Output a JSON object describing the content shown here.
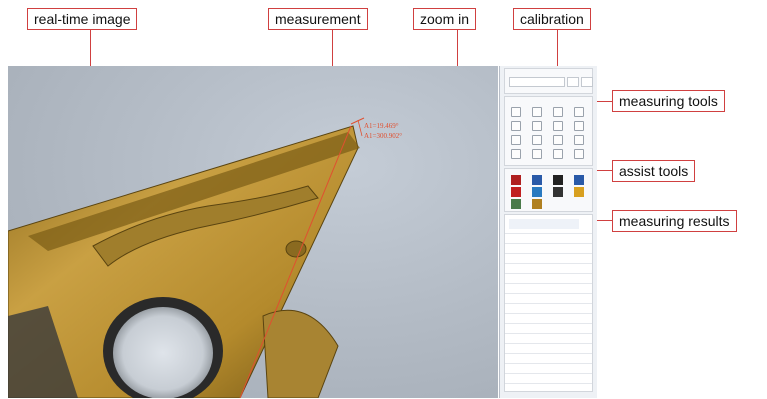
{
  "callouts": {
    "real_time_image": "real-time image",
    "measurement": "measurement",
    "zoom_in": "zoom in",
    "calibration": "calibration",
    "measuring_tools": "measuring tools",
    "assist_tools": "assist tools",
    "measuring_results": "measuring results"
  },
  "annotation_lines": [
    "A1=19.469°",
    "A1=300.902°"
  ],
  "tools": {
    "measuring": [
      "line-icon",
      "parallel-icon",
      "perpendicular-icon",
      "circle-icon",
      "rectangle-icon",
      "angle-icon",
      "arc-icon",
      "polygon-icon",
      "point-icon",
      "distance-icon",
      "radius-icon",
      "ellipse-icon",
      "curve-icon",
      "text-icon",
      "count-icon",
      "area-icon"
    ],
    "assist": [
      "color-icon",
      "edit-icon",
      "marker-icon",
      "camera-icon",
      "delete-icon",
      "save-icon",
      "clear-icon",
      "export-icon",
      "settings-icon",
      "report-icon"
    ]
  },
  "colors": {
    "callout_border": "#d04040",
    "measure_line": "#e05030",
    "insert_gold": "#c9a043",
    "panel_bg": "#eef1f5"
  }
}
